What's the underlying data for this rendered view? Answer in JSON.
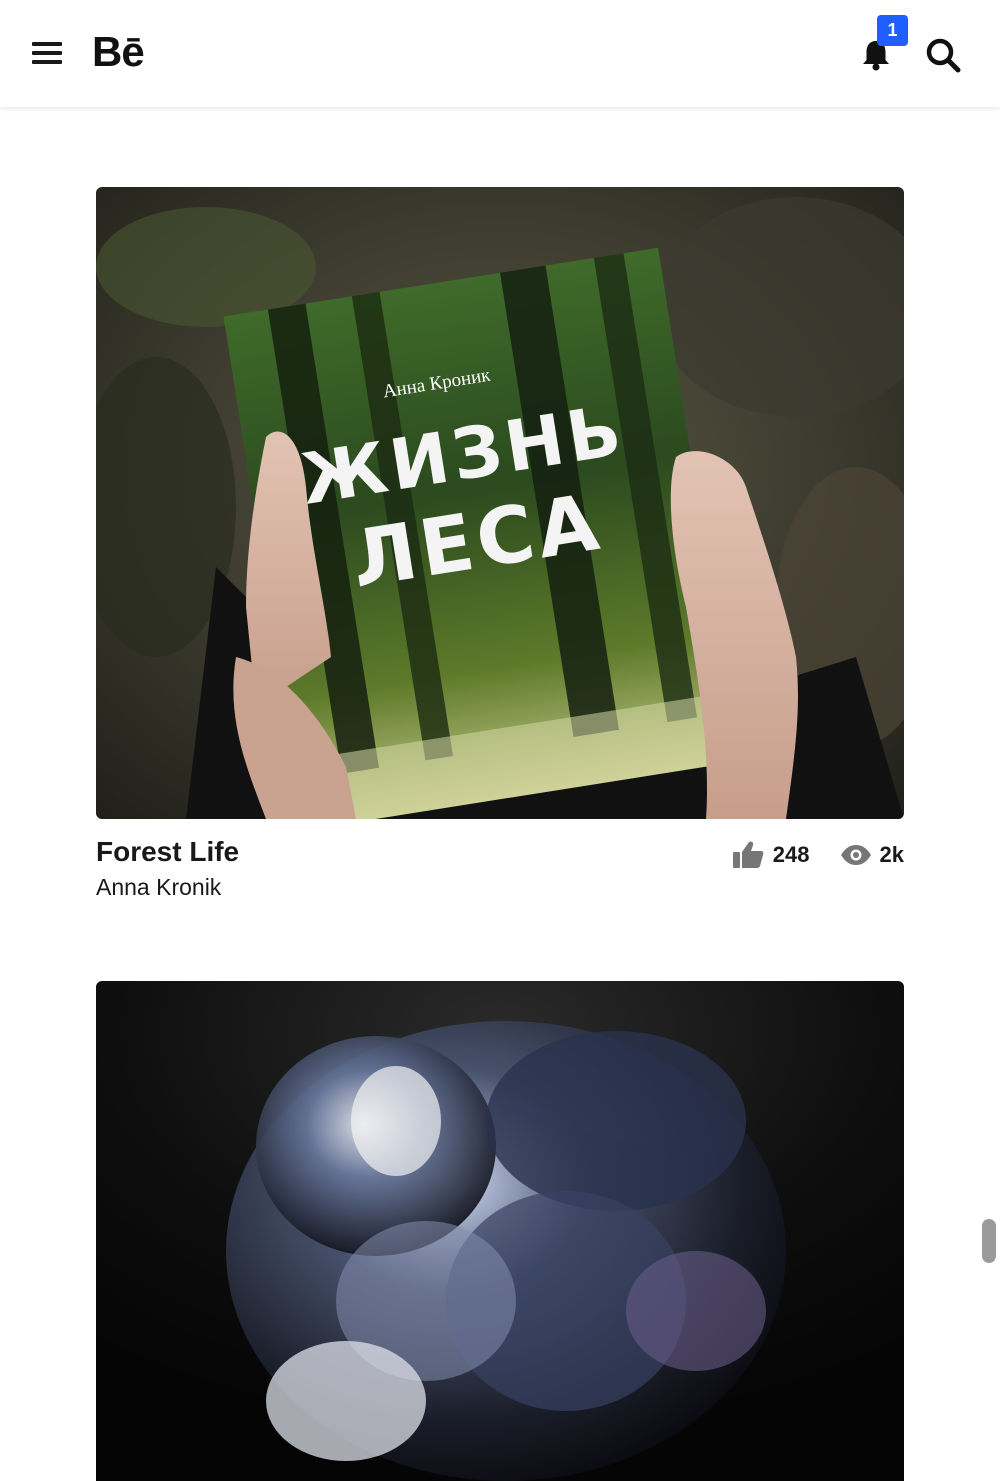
{
  "header": {
    "logo_text": "Bē",
    "notifications_count": "1",
    "icons": [
      "menu-icon",
      "bell-icon",
      "search-icon"
    ]
  },
  "projects": [
    {
      "title": "Forest Life",
      "owner": "Anna Kronik",
      "appreciations": "248",
      "views": "2k",
      "cover_text": {
        "author": "Анна Кроник",
        "title_line1": "ЖИЗНЬ",
        "title_line2": "ЛЕСА"
      }
    },
    {
      "title": "",
      "owner": ""
    }
  ],
  "colors": {
    "badge": "#1f5eff",
    "text": "#191919",
    "icon_gray": "#767676"
  }
}
